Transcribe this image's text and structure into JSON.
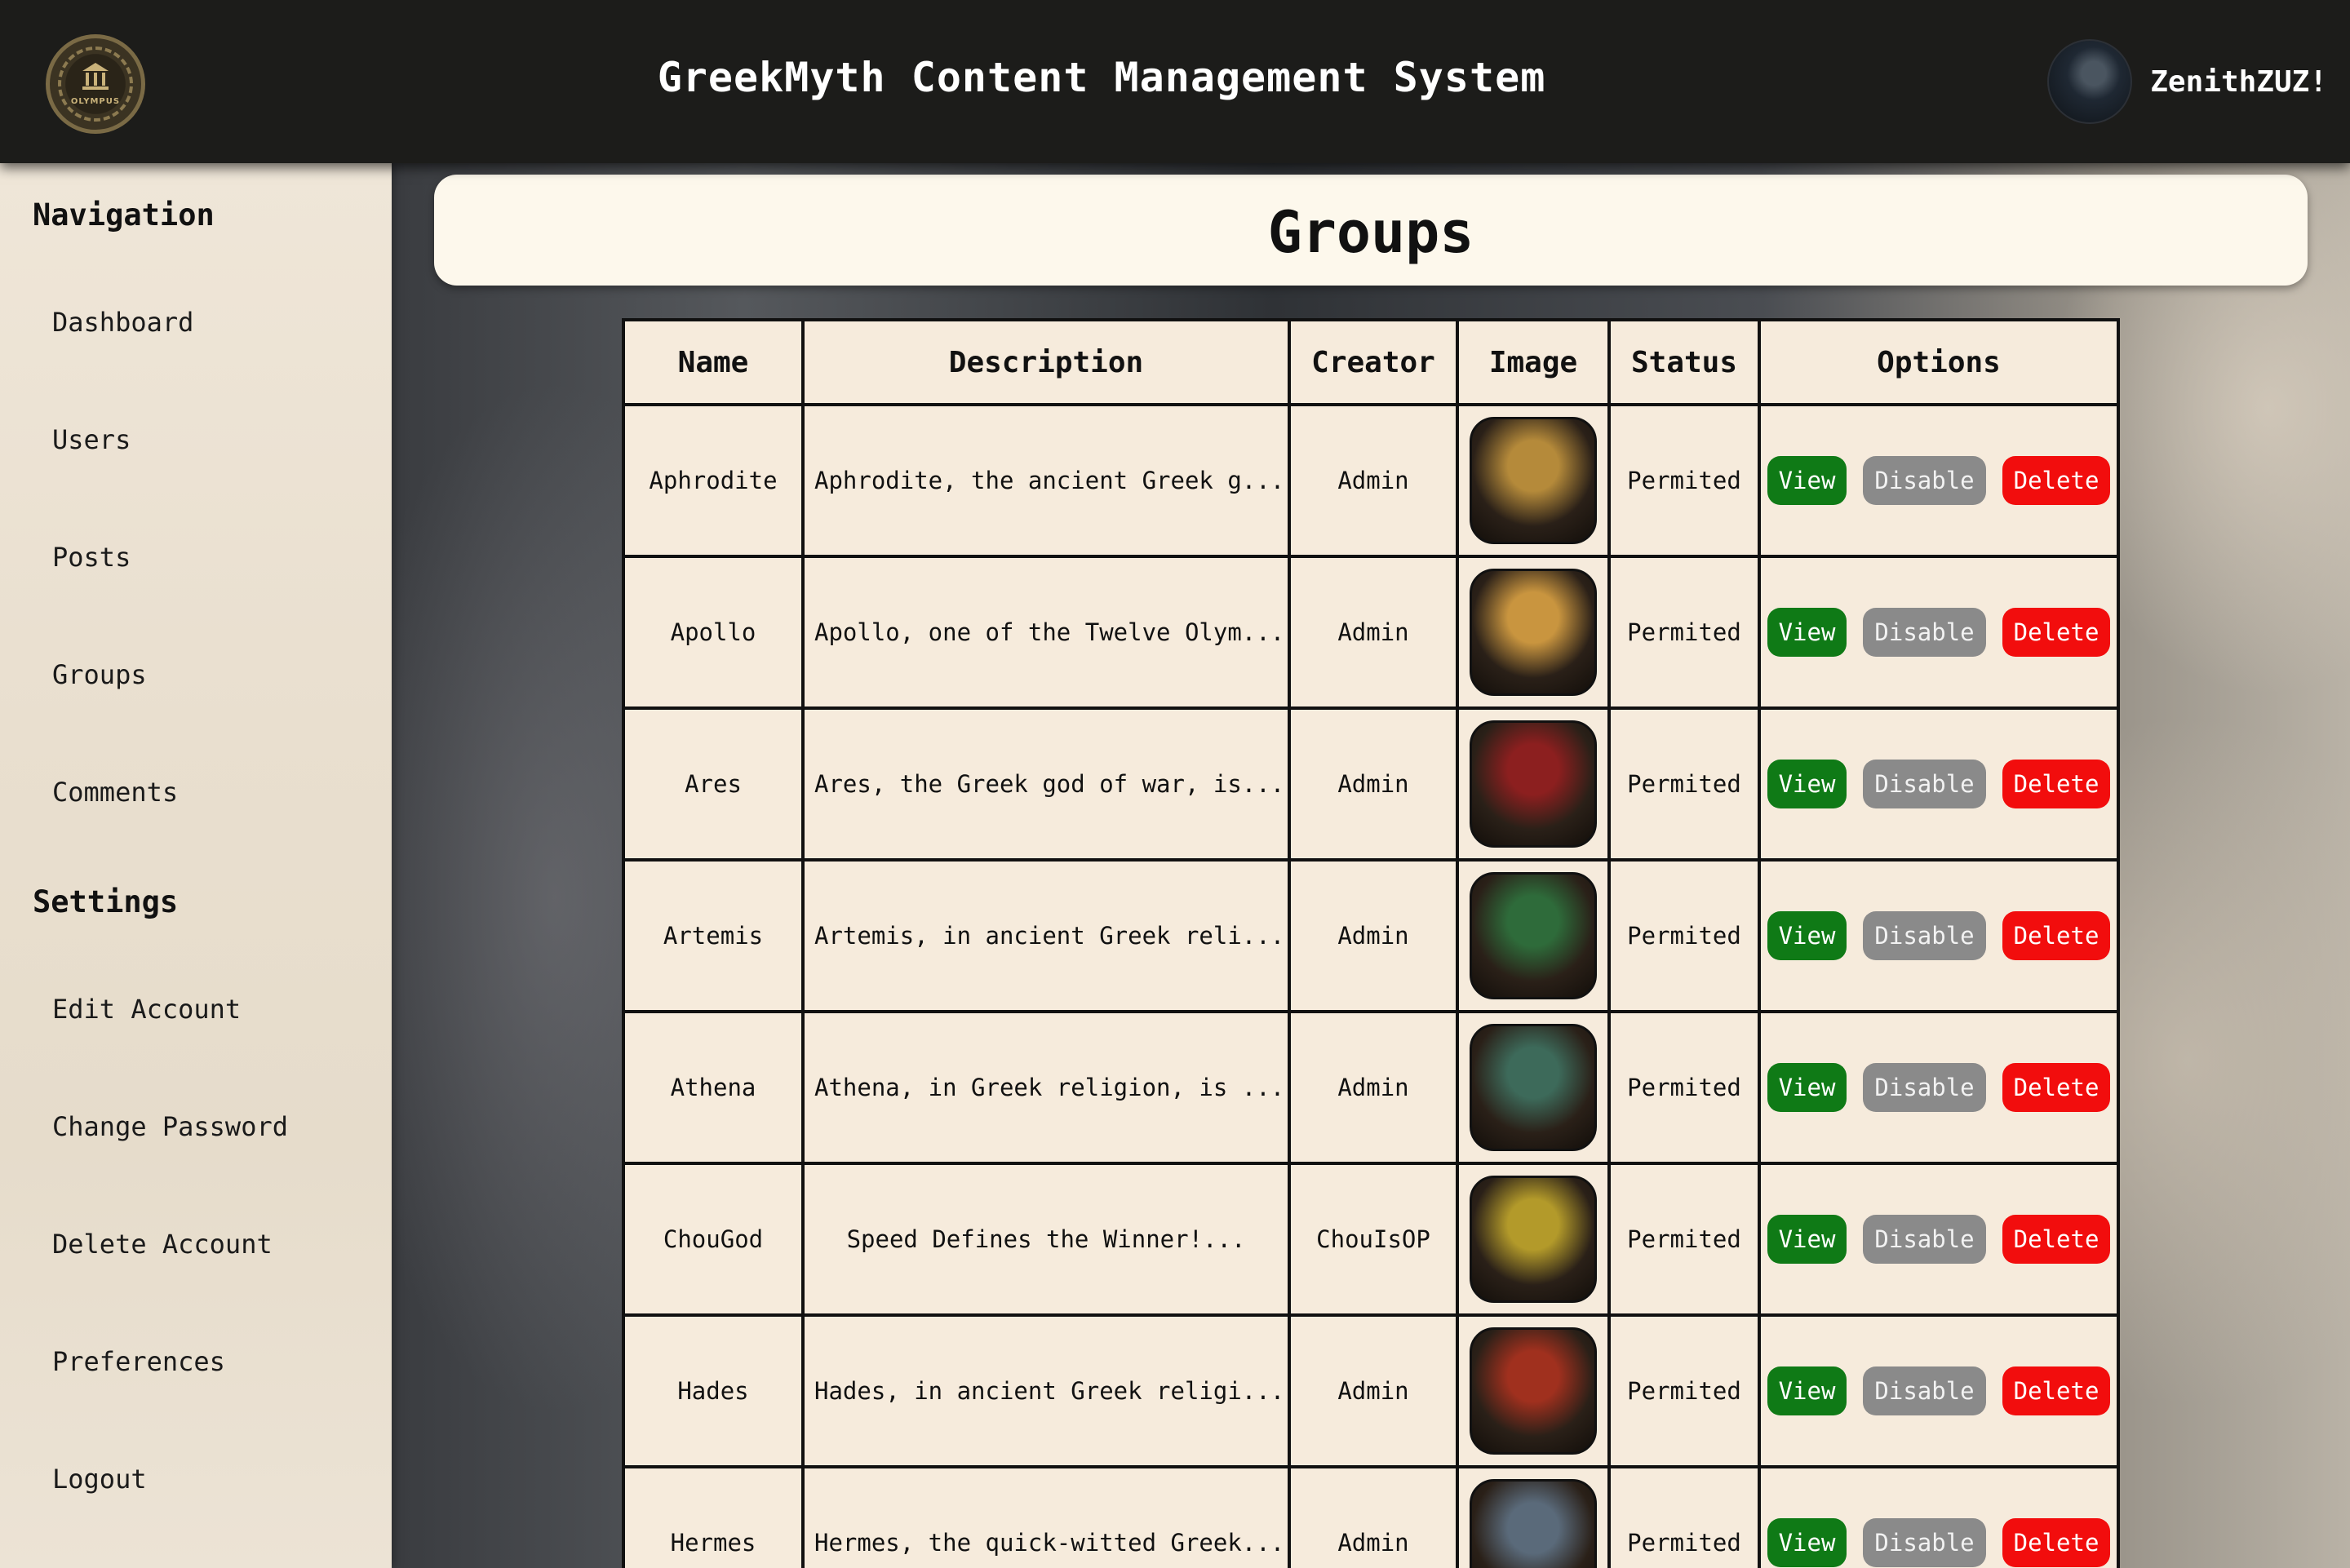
{
  "header": {
    "logo_text": "OLYMPUS",
    "title": "GreekMyth Content Management System",
    "username": "ZenithZUZ!"
  },
  "sidebar": {
    "navigation_heading": "Navigation",
    "nav_items": [
      {
        "label": "Dashboard"
      },
      {
        "label": "Users"
      },
      {
        "label": "Posts"
      },
      {
        "label": "Groups"
      },
      {
        "label": "Comments"
      }
    ],
    "settings_heading": "Settings",
    "settings_items": [
      {
        "label": "Edit Account"
      },
      {
        "label": "Change Password"
      },
      {
        "label": "Delete Account"
      },
      {
        "label": "Preferences"
      },
      {
        "label": "Logout"
      }
    ]
  },
  "page": {
    "title": "Groups"
  },
  "table": {
    "headers": {
      "name": "Name",
      "description": "Description",
      "creator": "Creator",
      "image": "Image",
      "status": "Status",
      "options": "Options"
    },
    "buttons": {
      "view": "View",
      "disable": "Disable",
      "delete": "Delete"
    },
    "rows": [
      {
        "name": "Aphrodite",
        "description": "Aphrodite, the ancient Greek g...",
        "creator": "Admin",
        "status": "Permited",
        "image_icon": "aphrodite-image",
        "color": "#b58a3a"
      },
      {
        "name": "Apollo",
        "description": "Apollo, one of the Twelve Olym...",
        "creator": "Admin",
        "status": "Permited",
        "image_icon": "apollo-image",
        "color": "#c9953f"
      },
      {
        "name": "Ares",
        "description": "Ares, the Greek god of war, is...",
        "creator": "Admin",
        "status": "Permited",
        "image_icon": "ares-image",
        "color": "#8c1f1f"
      },
      {
        "name": "Artemis",
        "description": "Artemis, in ancient Greek reli...",
        "creator": "Admin",
        "status": "Permited",
        "image_icon": "artemis-image",
        "color": "#2e6b3a"
      },
      {
        "name": "Athena",
        "description": "Athena, in Greek religion, is ...",
        "creator": "Admin",
        "status": "Permited",
        "image_icon": "athena-image",
        "color": "#3d6a5a"
      },
      {
        "name": "ChouGod",
        "description": "Speed Defines the Winner!...",
        "creator": "ChouIsOP",
        "status": "Permited",
        "image_icon": "chougod-image",
        "color": "#b39a2a"
      },
      {
        "name": "Hades",
        "description": "Hades, in ancient Greek religi...",
        "creator": "Admin",
        "status": "Permited",
        "image_icon": "hades-image",
        "color": "#a0301e"
      },
      {
        "name": "Hermes",
        "description": "Hermes, the quick-witted Greek...",
        "creator": "Admin",
        "status": "Permited",
        "image_icon": "hermes-image",
        "color": "#5a6a7a"
      }
    ]
  }
}
